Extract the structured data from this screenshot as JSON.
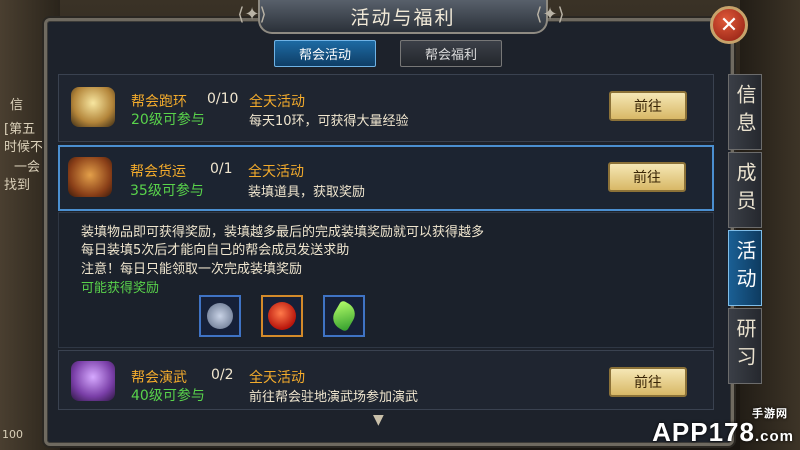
{
  "window": {
    "title": "活动与福利"
  },
  "top_tabs": [
    {
      "label": "帮会活动",
      "active": true
    },
    {
      "label": "帮会福利",
      "active": false
    }
  ],
  "side_tabs": [
    {
      "label": "信息",
      "active": false
    },
    {
      "label": "成员",
      "active": false
    },
    {
      "label": "活动",
      "active": true
    },
    {
      "label": "研习",
      "active": false
    }
  ],
  "activities": [
    {
      "name": "帮会跑环",
      "progress": "0/10",
      "time": "全天活动",
      "level": "20级可参与",
      "desc": "每天10环，可获得大量经验",
      "button": "前往"
    },
    {
      "name": "帮会货运",
      "progress": "0/1",
      "time": "全天活动",
      "level": "35级可参与",
      "desc": "装填道具，获取奖励",
      "button": "前往"
    },
    {
      "name": "帮会演武",
      "progress": "0/2",
      "time": "全天活动",
      "level": "40级可参与",
      "desc": "前往帮会驻地演武场参加演武",
      "button": "前往"
    }
  ],
  "detail": {
    "lines": [
      "装填物品即可获得奖励，装填越多最后的完成装填奖励就可以获得越多",
      "每日装填5次后才能向自己的帮会成员发送求助",
      "注意！每日只能领取一次完成装填奖励"
    ],
    "reward_title": "可能获得奖励"
  },
  "background_text": {
    "left_fragments": [
      "信",
      "[第五",
      "时候不",
      "一会",
      "找到"
    ],
    "bottom_left": "100"
  },
  "watermark": {
    "main": "APP178",
    "suffix": ".com",
    "sub": "手游网"
  },
  "colors": {
    "accent_orange": "#f3ab2c",
    "level_green": "#59d34b",
    "tab_blue": "#1d6aa3"
  }
}
